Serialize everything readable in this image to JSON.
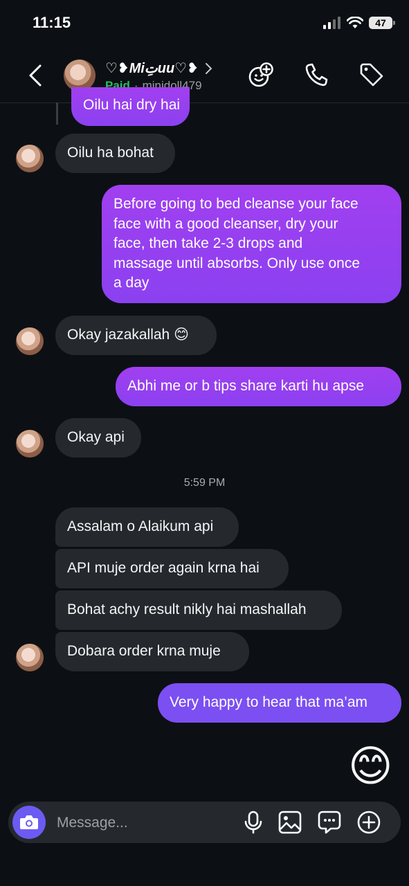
{
  "status_bar": {
    "time": "11:15",
    "battery": "47"
  },
  "header": {
    "display_name": "♡❥Miتِuu♡❥",
    "paid_label": "Paid",
    "separator": "·",
    "username": "minidoll479"
  },
  "messages": [
    {
      "side": "out",
      "text": "Oilu hai dry hai"
    },
    {
      "side": "in",
      "text": "Oilu ha bohat"
    },
    {
      "side": "out",
      "lines": [
        "Before going to bed cleanse your face",
        "face with a good cleanser, dry your",
        "face, then take 2-3 drops and",
        "massage until absorbs. Only use once",
        "a day"
      ]
    },
    {
      "side": "in",
      "text": "Okay jazakallah 😊"
    },
    {
      "side": "out",
      "text": "Abhi me or b tips share karti hu apse"
    },
    {
      "side": "in",
      "text": "Okay api"
    },
    {
      "side": "in",
      "text": "Assalam o Alaikum api"
    },
    {
      "side": "in",
      "text": "API muje order again krna hai"
    },
    {
      "side": "in",
      "text": "Bohat achy result nikly hai mashallah"
    },
    {
      "side": "in",
      "text": "Dobara order krna muje"
    },
    {
      "side": "out",
      "text": "Very happy to hear that ma’am"
    },
    {
      "side": "out",
      "text": "😊"
    }
  ],
  "timestamp": "5:59 PM",
  "composer": {
    "placeholder": "Message..."
  },
  "colors": {
    "background": "#0c1014",
    "incoming": "#25292e",
    "outgoing_purple": "#9b40f0",
    "outgoing_blue": "#7b4ff1",
    "paid_green": "#25c05d",
    "camera_button": "#6c5bf2"
  },
  "icons": [
    "back-chevron-icon",
    "chevron-right-icon",
    "sticker-add-icon",
    "phone-icon",
    "tag-icon",
    "camera-icon",
    "microphone-icon",
    "image-icon",
    "chat-sticker-icon",
    "plus-circle-icon"
  ]
}
